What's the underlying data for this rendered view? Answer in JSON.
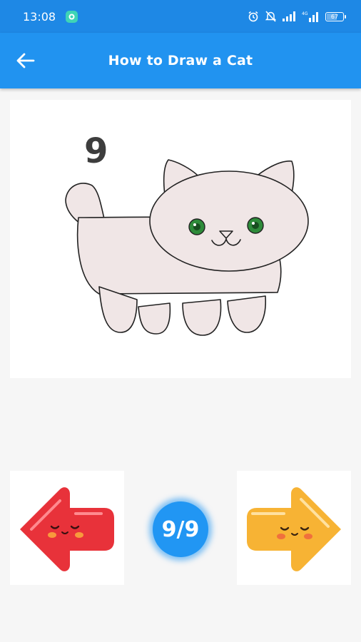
{
  "status_bar": {
    "time": "13:08",
    "battery": "67"
  },
  "app_bar": {
    "title": "How to Draw a Cat"
  },
  "drawing": {
    "step_number": "9"
  },
  "navigation": {
    "page_indicator": "9/9",
    "prev_color": "#e8323a",
    "next_color": "#f7b334"
  },
  "colors": {
    "status_bar": "#1e88e5",
    "app_bar": "#2193f0",
    "cat_fill": "#f0e6e6",
    "cat_eyes": "#2e8b3a"
  }
}
